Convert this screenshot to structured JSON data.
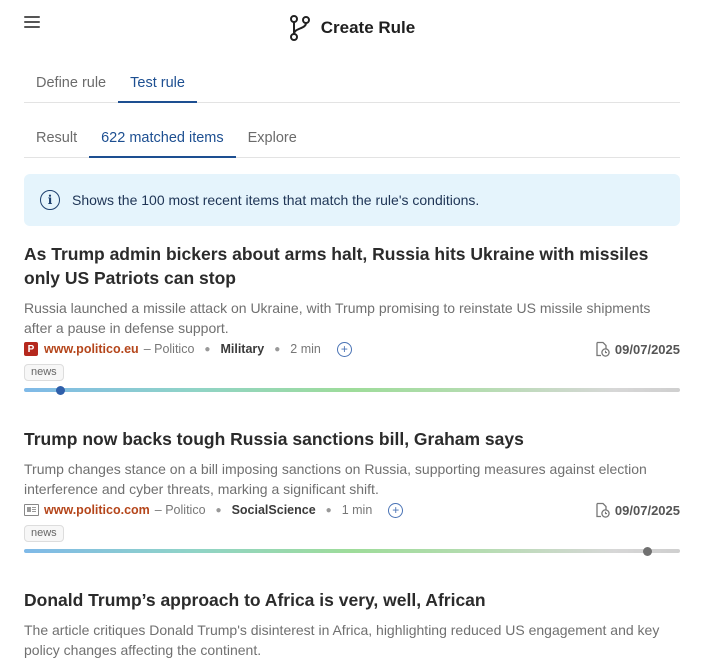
{
  "header": {
    "title": "Create Rule"
  },
  "tabs_main": [
    {
      "label": "Define rule",
      "active": false
    },
    {
      "label": "Test rule",
      "active": true
    }
  ],
  "tabs_sub": [
    {
      "label": "Result",
      "active": false
    },
    {
      "label": "622 matched items",
      "active": true
    },
    {
      "label": "Explore",
      "active": false
    }
  ],
  "info": {
    "text": "Shows the 100 most recent items that match the rule's conditions."
  },
  "articles": [
    {
      "title": "As Trump admin bickers about arms halt, Russia hits Ukraine with missiles only US Patriots can stop",
      "summary": "Russia launched a missile attack on Ukraine, with Trump promising to reinstate US missile shipments after a pause in defense support.",
      "source_icon": "publisher-logo-icon",
      "source_icon_letter": "P",
      "domain": "www.politico.eu",
      "publisher": "– Politico",
      "category": "Military",
      "read_time": "2 min",
      "date": "09/07/2025",
      "tag": "news",
      "slider_fraction": 0.056,
      "knob_color": "#2f5faa"
    },
    {
      "title": "Trump now backs tough Russia sanctions bill, Graham says",
      "summary": "Trump changes stance on a bill imposing sanctions on Russia, supporting measures against election interference and cyber threats, marking a significant shift.",
      "source_icon": "newspaper-icon",
      "domain": "www.politico.com",
      "publisher": "– Politico",
      "category": "SocialScience",
      "read_time": "1 min",
      "date": "09/07/2025",
      "tag": "news",
      "slider_fraction": 950,
      "knob_color": "#707070"
    },
    {
      "title": "Donald Trump’s approach to Africa is very, well, African",
      "summary": "The article critiques Donald Trump's disinterest in Africa, highlighting reduced US engagement and key policy changes affecting the continent."
    }
  ],
  "colors": {
    "accent": "#1d4f91",
    "info_bg": "#e5f4fc",
    "domain": "#b5461b"
  }
}
